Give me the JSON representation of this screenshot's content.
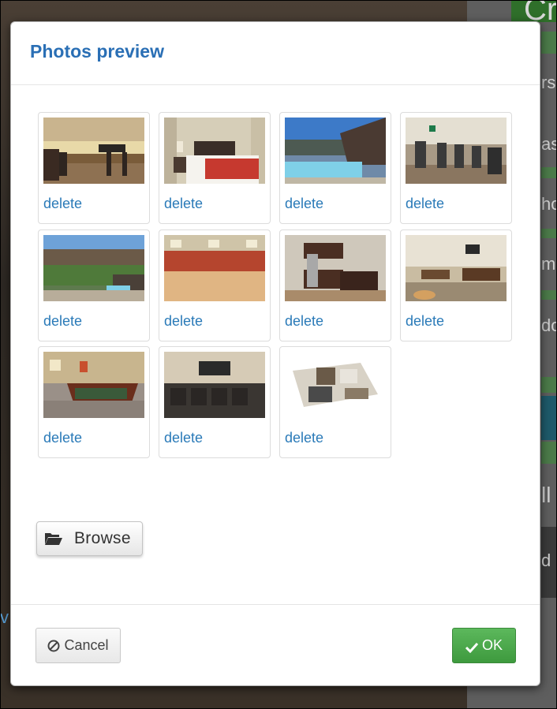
{
  "background": {
    "title_fragment": "Cr",
    "side_letters": [
      "rs",
      "as",
      "ho",
      "m",
      "do",
      "ll",
      "d"
    ],
    "link_fragment": "v"
  },
  "dialog": {
    "title": "Photos preview",
    "photos": [
      {
        "label": "delete",
        "icon": "lounge-photo"
      },
      {
        "label": "delete",
        "icon": "bedroom-photo"
      },
      {
        "label": "delete",
        "icon": "pool-photo"
      },
      {
        "label": "delete",
        "icon": "gym-photo"
      },
      {
        "label": "delete",
        "icon": "courtyard-photo"
      },
      {
        "label": "delete",
        "icon": "sports-court-photo"
      },
      {
        "label": "delete",
        "icon": "kitchen-photo"
      },
      {
        "label": "delete",
        "icon": "game-room-photo"
      },
      {
        "label": "delete",
        "icon": "billiards-photo"
      },
      {
        "label": "delete",
        "icon": "theater-room-photo"
      },
      {
        "label": "delete",
        "icon": "floor-plan-photo"
      }
    ],
    "browse_label": "Browse",
    "cancel_label": "Cancel",
    "ok_label": "OK"
  },
  "colors": {
    "title": "#2a6fb5",
    "link": "#2a7ab8",
    "ok": "#4cae4c"
  }
}
